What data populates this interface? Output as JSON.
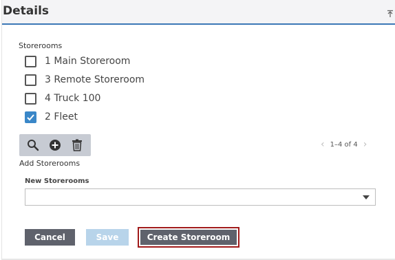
{
  "header": {
    "title": "Details",
    "collapse_icon": "collapse-up-icon"
  },
  "storerooms": {
    "label": "Storerooms",
    "items": [
      {
        "label": "1 Main Storeroom",
        "checked": false
      },
      {
        "label": "3 Remote Storeroom",
        "checked": false
      },
      {
        "label": "4 Truck 100",
        "checked": false
      },
      {
        "label": "2 Fleet",
        "checked": true
      }
    ]
  },
  "toolbar": {
    "icons": [
      "search-icon",
      "add-circle-icon",
      "trash-icon"
    ]
  },
  "pager": {
    "text": "1–4 of 4",
    "prev": "‹",
    "next": "›"
  },
  "add_storerooms": {
    "label": "Add Storerooms",
    "field_label": "New Storerooms",
    "value": ""
  },
  "buttons": {
    "cancel": "Cancel",
    "save": "Save",
    "create": "Create Storeroom"
  },
  "colors": {
    "accent": "#3a87c8",
    "header_border": "#3b77b6",
    "button_dark": "#5f626c",
    "button_disabled": "#b8d4ea",
    "highlight_border": "#a01a1a"
  }
}
